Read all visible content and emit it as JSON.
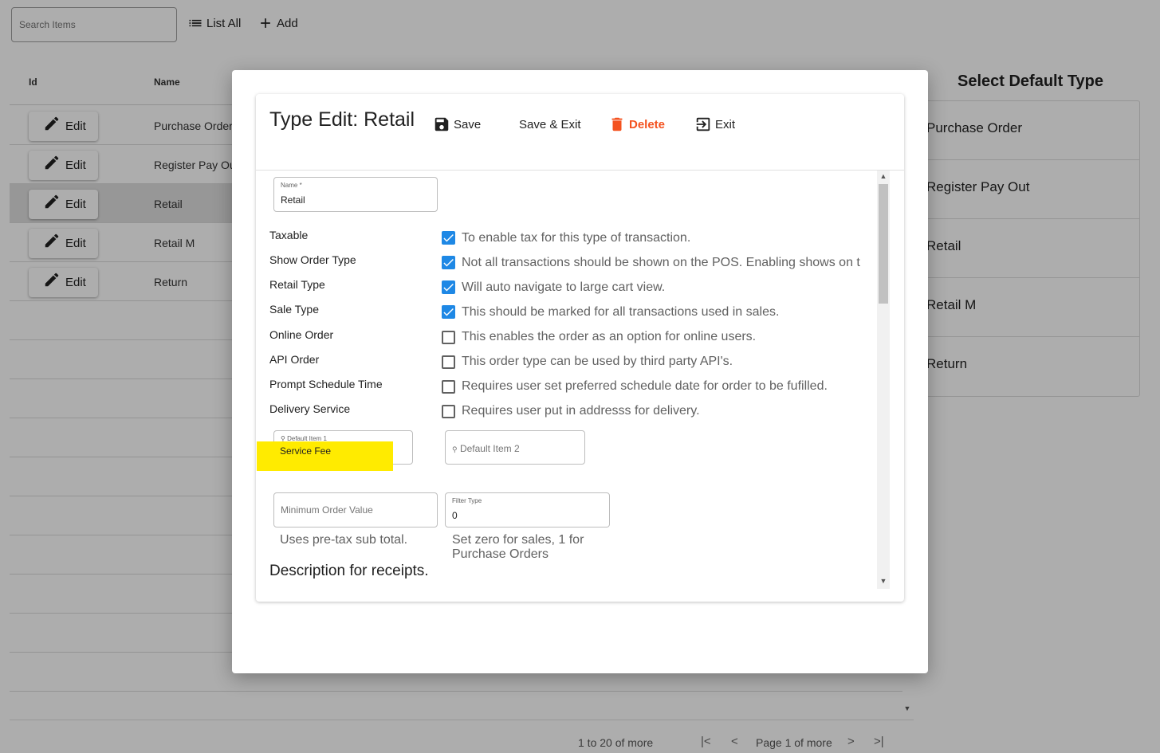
{
  "toolbar": {
    "search_placeholder": "Search Items",
    "list_all_label": "List All",
    "add_label": "Add"
  },
  "grid": {
    "columns": [
      "Id",
      "Name"
    ],
    "edit_label": "Edit",
    "rows": [
      {
        "name": "Purchase Order"
      },
      {
        "name": "Register Pay Out"
      },
      {
        "name": "Retail"
      },
      {
        "name": "Retail M"
      },
      {
        "name": "Return"
      }
    ],
    "pager": {
      "range_text": "1 to 20 of more",
      "page_text": "Page 1 of more"
    }
  },
  "side_panel": {
    "title": "Select Default Type",
    "items": [
      "Purchase Order",
      "Register Pay Out",
      "Retail",
      "Retail M",
      "Return"
    ]
  },
  "dialog": {
    "title": "Type Edit: Retail",
    "buttons": {
      "save": "Save",
      "save_exit": "Save & Exit",
      "delete": "Delete",
      "exit": "Exit"
    },
    "name_field": {
      "label": "Name *",
      "value": "Retail"
    },
    "options": [
      {
        "label": "Taxable",
        "checked": true,
        "description": "To enable tax for this type of transaction."
      },
      {
        "label": "Show Order Type",
        "checked": true,
        "description": "Not all transactions should be shown on the POS. Enabling shows on t"
      },
      {
        "label": "Retail Type",
        "checked": true,
        "description": "Will auto navigate to large cart view."
      },
      {
        "label": "Sale Type",
        "checked": true,
        "description": "This should be marked for all transactions used in sales."
      },
      {
        "label": "Online Order",
        "checked": false,
        "description": "This enables the order as an option for online users."
      },
      {
        "label": "API Order",
        "checked": false,
        "description": "This order type can be used by third party API's."
      },
      {
        "label": "Prompt Schedule Time",
        "checked": false,
        "description": "Requires user set preferred schedule date for order to be fufilled."
      },
      {
        "label": "Delivery Service",
        "checked": false,
        "description": "Requires user put in addresss for delivery."
      }
    ],
    "default_item_1": {
      "label": "Default Item 1",
      "value": "Service Fee"
    },
    "default_item_2": {
      "placeholder": "Default Item 2"
    },
    "min_order": {
      "placeholder": "Minimum Order Value",
      "hint": "Uses pre-tax sub total."
    },
    "filter_type": {
      "label": "Filter Type",
      "value": "0",
      "hint": "Set zero for sales, 1 for Purchase Orders"
    },
    "description_title": "Description for receipts."
  },
  "colors": {
    "accent": "#1e88e5",
    "delete": "#f4511e",
    "highlight": "#ffeb00"
  }
}
